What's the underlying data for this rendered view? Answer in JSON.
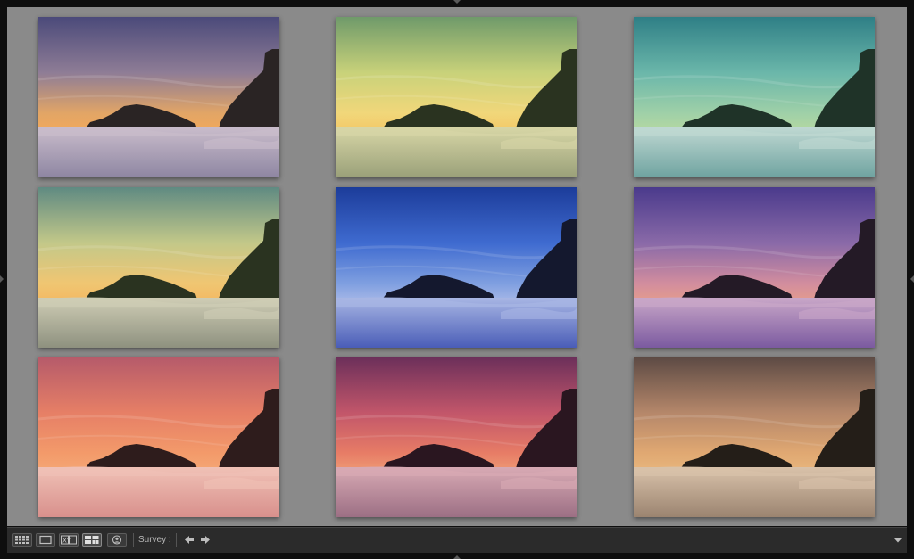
{
  "toolbar": {
    "survey_label": "Survey :",
    "view_buttons": [
      {
        "name": "grid-view-icon"
      },
      {
        "name": "loupe-view-icon"
      },
      {
        "name": "compare-view-icon"
      },
      {
        "name": "survey-view-icon"
      },
      {
        "name": "people-view-icon"
      }
    ],
    "compare_xy_glyph": "XY"
  },
  "photos": [
    {
      "sky": [
        "#4b4a7a",
        "#8f7d96",
        "#e2a566",
        "#f2a95a"
      ],
      "fog": [
        "#c9bccb",
        "#8e86a2"
      ],
      "rock": "#2a2424"
    },
    {
      "sky": [
        "#6f9a6a",
        "#c9d27a",
        "#f1d77a",
        "#f3c765"
      ],
      "fog": [
        "#d7d6a6",
        "#9aa079"
      ],
      "rock": "#2a3320"
    },
    {
      "sky": [
        "#2f7f86",
        "#6bb7aa",
        "#9fd0a8",
        "#b7d9a0"
      ],
      "fog": [
        "#bfd8d2",
        "#6fa3a0"
      ],
      "rock": "#1f3328"
    },
    {
      "sky": [
        "#5f8a82",
        "#c3c889",
        "#f0c672",
        "#f3b862"
      ],
      "fog": [
        "#cfcdb5",
        "#8e917f"
      ],
      "rock": "#2a3320"
    },
    {
      "sky": [
        "#1c3c9a",
        "#3f6bd0",
        "#7f9fe0",
        "#a9b9e8"
      ],
      "fog": [
        "#a8b6e4",
        "#4a5db7"
      ],
      "rock": "#14182e"
    },
    {
      "sky": [
        "#4a3a8c",
        "#8a6aa8",
        "#d28d9e",
        "#e59d8c"
      ],
      "fog": [
        "#c9a7c8",
        "#7b5aa0"
      ],
      "rock": "#241a26"
    },
    {
      "sky": [
        "#b55a6a",
        "#e67f66",
        "#f39a6a",
        "#f4a775"
      ],
      "fog": [
        "#f0c1b6",
        "#d8908c"
      ],
      "rock": "#2e1c1c"
    },
    {
      "sky": [
        "#6b2f5a",
        "#c2566a",
        "#e77c66",
        "#ee9b75"
      ],
      "fog": [
        "#d8aab4",
        "#9c6f84"
      ],
      "rock": "#2a1620"
    },
    {
      "sky": [
        "#5c4a44",
        "#b5876a",
        "#e0a872",
        "#e8b67d"
      ],
      "fog": [
        "#d9c2aa",
        "#9b8470"
      ],
      "rock": "#241e18"
    }
  ]
}
